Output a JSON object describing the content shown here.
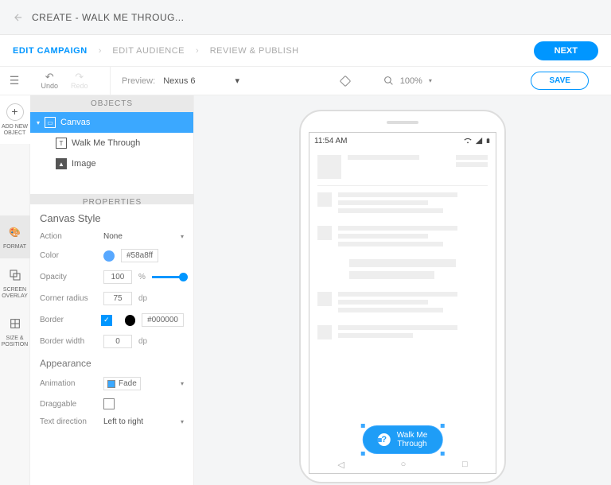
{
  "header": {
    "title": "CREATE - WALK ME THROUG..."
  },
  "steps": {
    "s1": "EDIT CAMPAIGN",
    "s2": "EDIT AUDIENCE",
    "s3": "REVIEW & PUBLISH",
    "next": "NEXT"
  },
  "toolbar": {
    "undo": "Undo",
    "redo": "Redo",
    "preview": "Preview:",
    "device": "Nexus 6",
    "zoom": "100%",
    "save": "SAVE"
  },
  "left_tools": {
    "add": "ADD NEW OBJECT",
    "format": "FORMAT",
    "overlay": "SCREEN OVERLAY",
    "size": "SIZE & POSITION"
  },
  "panels": {
    "objects": "OBJECTS",
    "properties": "PROPERTIES"
  },
  "objects": {
    "canvas": "Canvas",
    "walk": "Walk Me Through",
    "image": "Image"
  },
  "props": {
    "title": "Canvas Style",
    "action_lbl": "Action",
    "action_val": "None",
    "color_lbl": "Color",
    "color_val": "#58a8ff",
    "opacity_lbl": "Opacity",
    "opacity_val": "100",
    "opacity_unit": "%",
    "radius_lbl": "Corner radius",
    "radius_val": "75",
    "dp": "dp",
    "border_lbl": "Border",
    "border_color": "#000000",
    "bwidth_lbl": "Border width",
    "bwidth_val": "0",
    "appearance": "Appearance",
    "anim_lbl": "Animation",
    "anim_val": "Fade",
    "drag_lbl": "Draggable",
    "textdir_lbl": "Text direction",
    "textdir_val": "Left to right"
  },
  "phone": {
    "time": "11:54 AM",
    "cta_line1": "Walk Me",
    "cta_line2": "Through"
  }
}
